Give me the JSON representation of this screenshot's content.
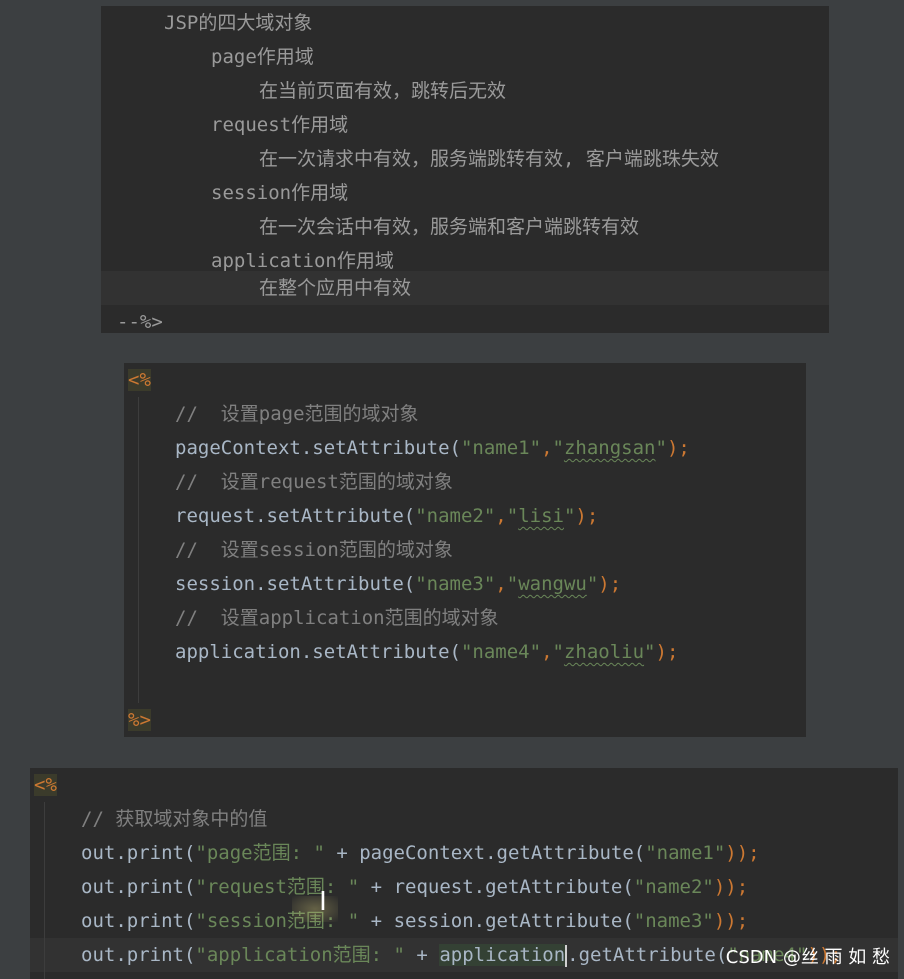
{
  "top_block": {
    "lines": [
      {
        "indent": 3,
        "text": "JSP的四大域对象"
      },
      {
        "indent": 5,
        "text": "page作用域"
      },
      {
        "indent": 7,
        "text": "在当前页面有效，跳转后无效"
      },
      {
        "indent": 5,
        "text": "request作用域"
      },
      {
        "indent": 7,
        "text": "在一次请求中有效，服务端跳转有效, 客户端跳珠失效"
      },
      {
        "indent": 5,
        "text": "session作用域"
      },
      {
        "indent": 7,
        "text": "在一次会话中有效，服务端和客户端跳转有效"
      },
      {
        "indent": 5,
        "text": "application作用域"
      },
      {
        "indent": 7,
        "text": "在整个应用中有效"
      }
    ],
    "closing": "--%>"
  },
  "middle_block": {
    "open_tag": "<%",
    "close_tag": "%>",
    "comments": {
      "page": "//  设置page范围的域对象",
      "request": "//  设置request范围的域对象",
      "session": "//  设置session范围的域对象",
      "application": "//  设置application范围的域对象"
    },
    "statements": [
      {
        "obj": "pageContext.setAttribute(",
        "key": "\"name1\"",
        "sep": ",",
        "val": "zhangsan",
        "end": ");"
      },
      {
        "obj": "request.setAttribute(",
        "key": "\"name2\"",
        "sep": ",",
        "val": "lisi",
        "end": ");"
      },
      {
        "obj": "session.setAttribute(",
        "key": "\"name3\"",
        "sep": ",",
        "val": "wangwu",
        "end": ");"
      },
      {
        "obj": "application.setAttribute(",
        "key": "\"name4\"",
        "sep": ",",
        "val": "zhaoliu",
        "end": ");"
      }
    ]
  },
  "bottom_block": {
    "open_tag": "<%",
    "comment": "// 获取域对象中的值",
    "lines": [
      {
        "pre": "out.print(",
        "label": "\"page范围: \"",
        "plus": " + ",
        "call": "pageContext.getAttribute(",
        "key": "\"name1\"",
        "end": "));"
      },
      {
        "pre": "out.print(",
        "label": "\"request范围: \"",
        "plus": " + ",
        "call": "request.getAttribute(",
        "key": "\"name2\"",
        "end": "));"
      },
      {
        "pre": "out.print(",
        "label": "\"session范围: \"",
        "plus": " + ",
        "call": "session.getAttribute(",
        "key": "\"name3\"",
        "end": "));"
      },
      {
        "pre": "out.print(",
        "label": "\"application范围: \"",
        "plus": " + ",
        "call_hl": "application",
        "call_rest": ".getAttribute(",
        "key": "\"name4\"",
        "end": "));"
      }
    ]
  },
  "watermark": "CSDN @丝 雨 如 愁",
  "cursor_glyph": "I"
}
